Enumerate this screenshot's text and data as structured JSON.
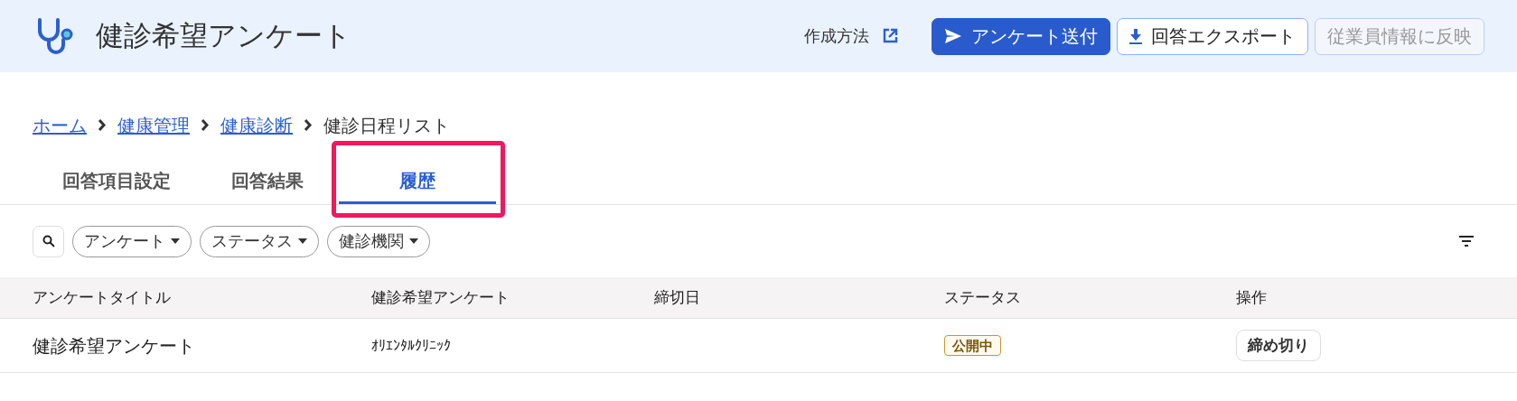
{
  "header": {
    "title": "健診希望アンケート",
    "help_link": "作成方法",
    "buttons": [
      {
        "kind": "primary",
        "label": "アンケート送付",
        "disabled": false
      },
      {
        "kind": "outline",
        "label": "回答エクスポート",
        "disabled": false
      },
      {
        "kind": "outline",
        "label": "従業員情報に反映",
        "disabled": true
      }
    ]
  },
  "breadcrumb": [
    {
      "label": "ホーム",
      "link": true
    },
    {
      "label": "健康管理",
      "link": true
    },
    {
      "label": "健康診断",
      "link": true
    },
    {
      "label": "健診日程リスト",
      "link": false
    }
  ],
  "tabs": [
    {
      "label": "回答項目設定",
      "selected": false,
      "highlighted": false
    },
    {
      "label": "回答結果",
      "selected": false,
      "highlighted": false
    },
    {
      "label": "履歴",
      "selected": true,
      "highlighted": true
    }
  ],
  "filters": [
    "アンケート",
    "ステータス",
    "健診機関"
  ],
  "table": {
    "columns": [
      "アンケートタイトル",
      "健診希望アンケート",
      "締切日",
      "ステータス",
      "操作"
    ],
    "rows": [
      {
        "title": "健診希望アンケート",
        "clinic": "ｵﾘｴﾝﾀﾙｸﾘﾆｯｸ",
        "status": "公開中",
        "action": "締め切り"
      }
    ]
  }
}
